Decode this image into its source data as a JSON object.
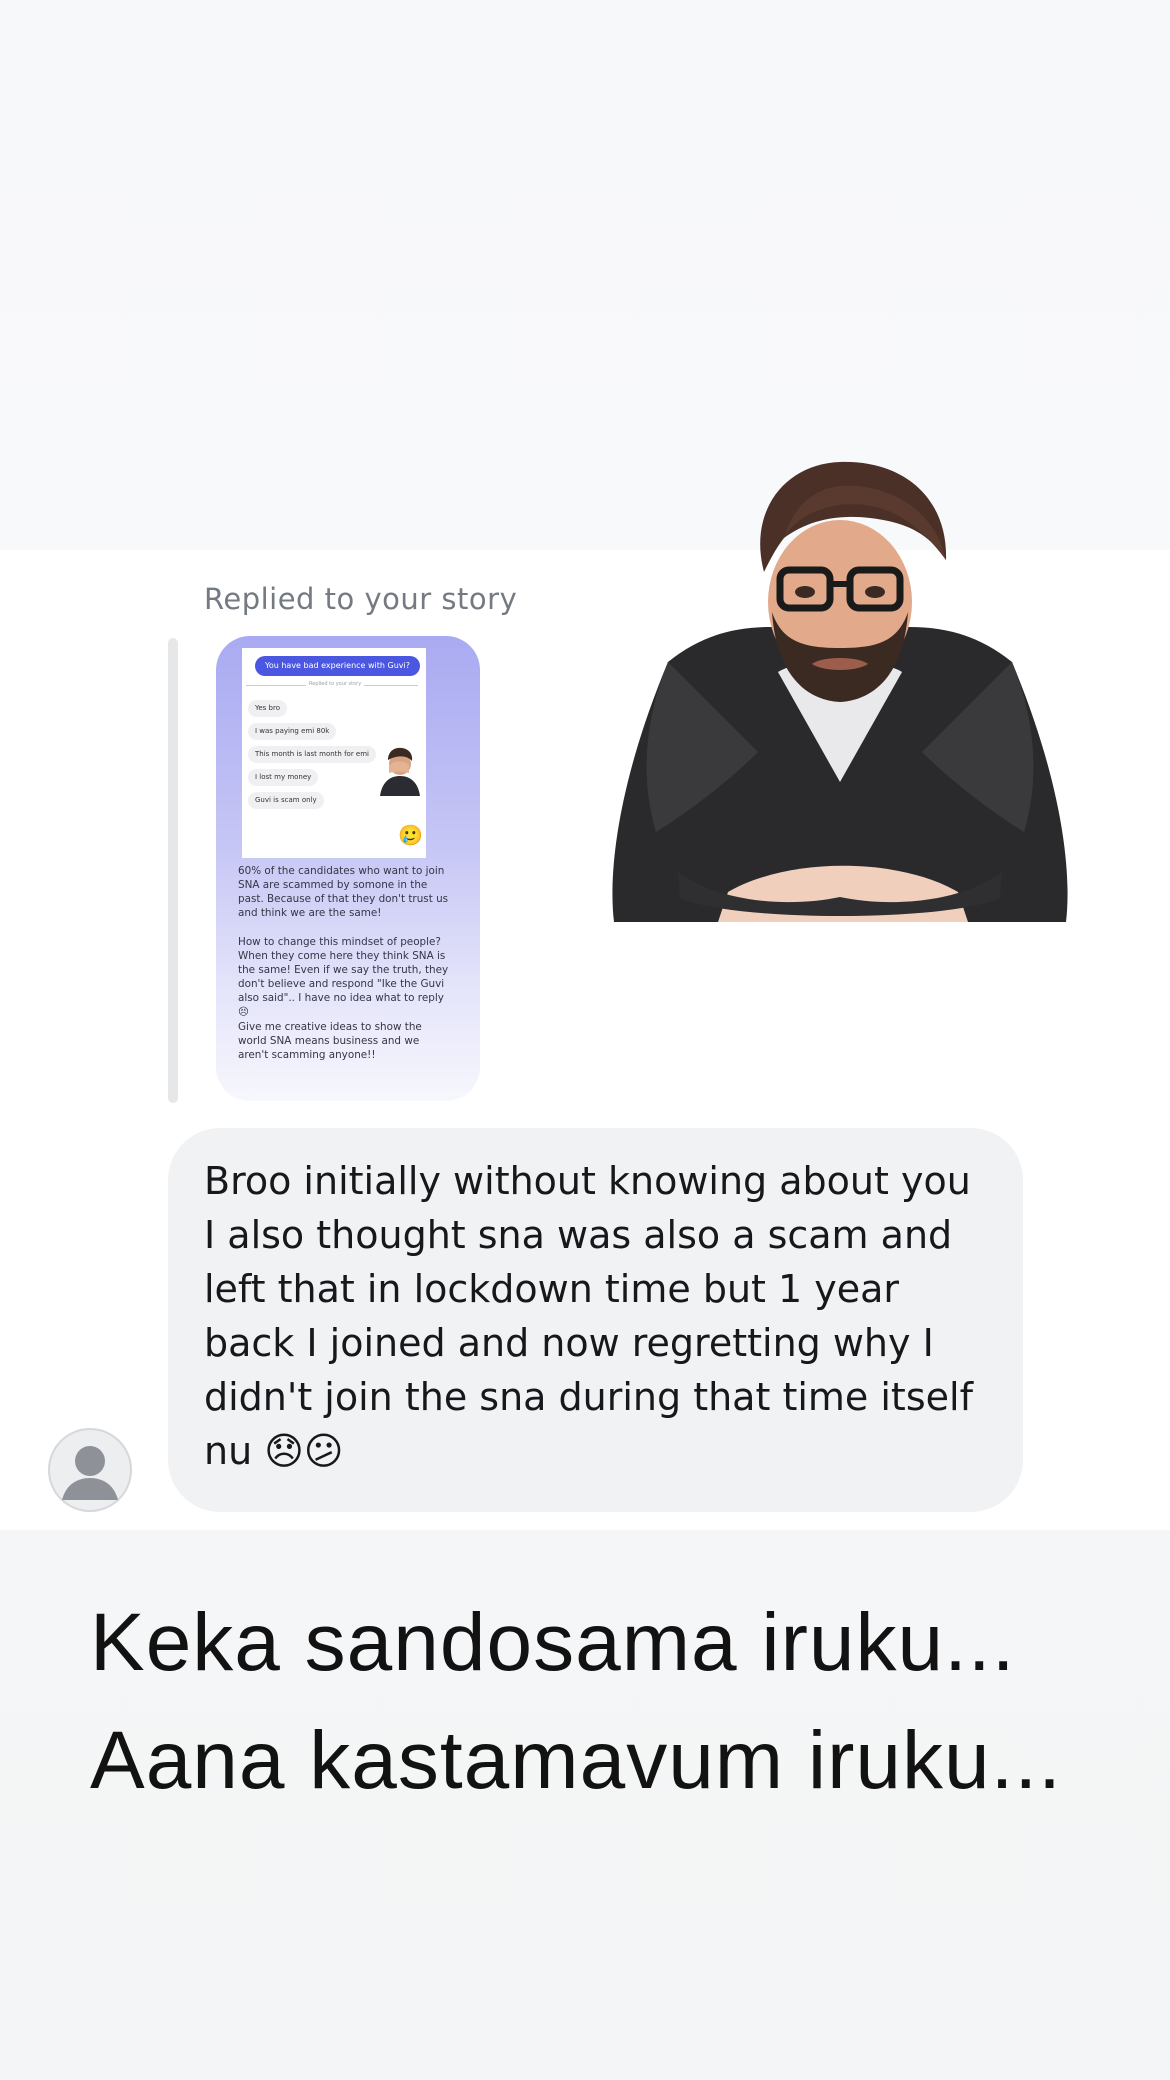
{
  "reply": {
    "label": "Replied to your story"
  },
  "story": {
    "screenshot": {
      "header_bubble": "You have bad experience with Guvi?",
      "meta": "Replied to your story",
      "messages": [
        "Yes bro",
        "I was paying  emi 80k",
        "This month is last month for emi",
        "I lost my money",
        "Guvi is scam only"
      ],
      "reaction_emoji": "🥲"
    },
    "paragraphs": [
      "60% of the candidates who want to join SNA are scammed by somone in the past. Because of that they don't trust us and think we are the same!",
      "How to change this mindset of people? When they come here they think SNA is the same! Even if we say the truth, they don't believe and respond \"Ike the Guvi also said\".. I have no idea what to reply 😣",
      "Give me creative ideas to show the world SNA means business and we aren't scamming anyone!!"
    ]
  },
  "message": {
    "text": "Broo initially without knowing about you I also thought sna was also a scam and left that in lockdown time but 1 year back I joined and now regretting why I didn't join the sna during that time itself nu 😞😕"
  },
  "caption": {
    "line1": "Keka sandosama iruku...",
    "line2": "Aana kastamavum iruku..."
  },
  "colors": {
    "bubble": "#f1f2f4",
    "story_gradient_top": "#a9aaf2",
    "accent_blue": "#4b57e0"
  },
  "icons": {
    "avatar": "default-user-avatar-icon",
    "sticker": "memoji-sticker"
  }
}
